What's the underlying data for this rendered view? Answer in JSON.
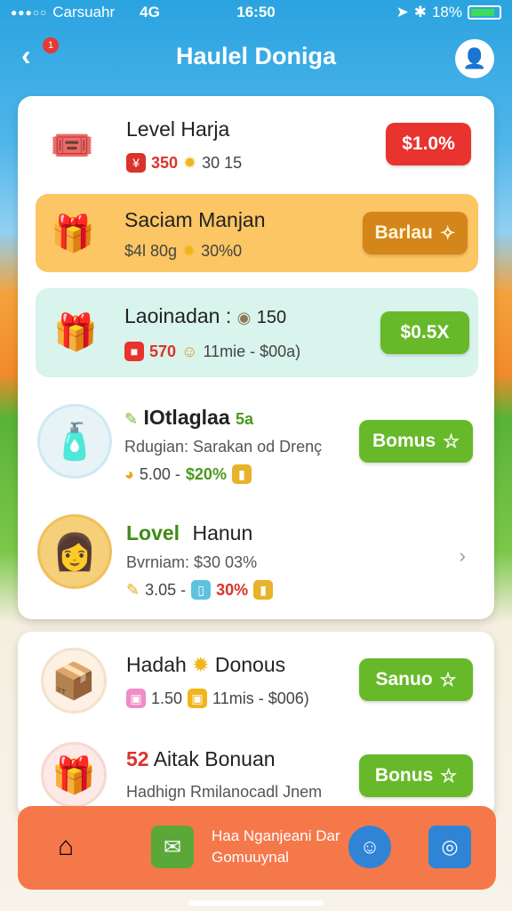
{
  "status": {
    "carrier": "Carsuahr",
    "network": "4G",
    "time": "16:50",
    "battery": "18%"
  },
  "header": {
    "title": "Haulel Doniga",
    "back_badge": "1"
  },
  "items": [
    {
      "title": "Level Harja",
      "meta1": "350",
      "meta2": "30 15",
      "button": "$1.0%"
    },
    {
      "title": "Saciam Manjan",
      "meta1": "$4l 80g",
      "meta2": "30%0",
      "button": "Barlau"
    },
    {
      "title": "Laoinadan :",
      "title_extra": "150",
      "meta1": "570",
      "meta2": "11mie - $00a)",
      "button": "$0.5X"
    },
    {
      "title": "IOtlaglaa",
      "title_extra": "5a",
      "subtitle": "Rdugian: Sarakan od Drenç",
      "meta1": "5.00 -",
      "meta2": "$20%",
      "button": "Bomus"
    },
    {
      "title": "Lovel",
      "title_extra": "Hanun",
      "subtitle": "Bvrniam: $30 03%",
      "meta1": "3.05 -",
      "meta2": "30%"
    }
  ],
  "items2": [
    {
      "title": "Hadah",
      "title_extra": "Donous",
      "meta1": "1.50",
      "meta2": "11mis - $006)",
      "button": "Sanuo"
    },
    {
      "title_prefix": "52",
      "title": "Aitak Bonuan",
      "subtitle": "Hadhign Rmilanocadl Jnem",
      "button": "Bonus"
    }
  ],
  "bottom_nav": {
    "line1": "Haa Nganjeani Dar",
    "line2": "Gomuuynal"
  },
  "colors": {
    "accent_blue": "#2aa3e0",
    "red": "#e8332f",
    "green": "#67b92a",
    "nav_orange": "#f5784a",
    "highlight_yellow": "#fbc663",
    "highlight_mint": "#d8f4ec"
  }
}
